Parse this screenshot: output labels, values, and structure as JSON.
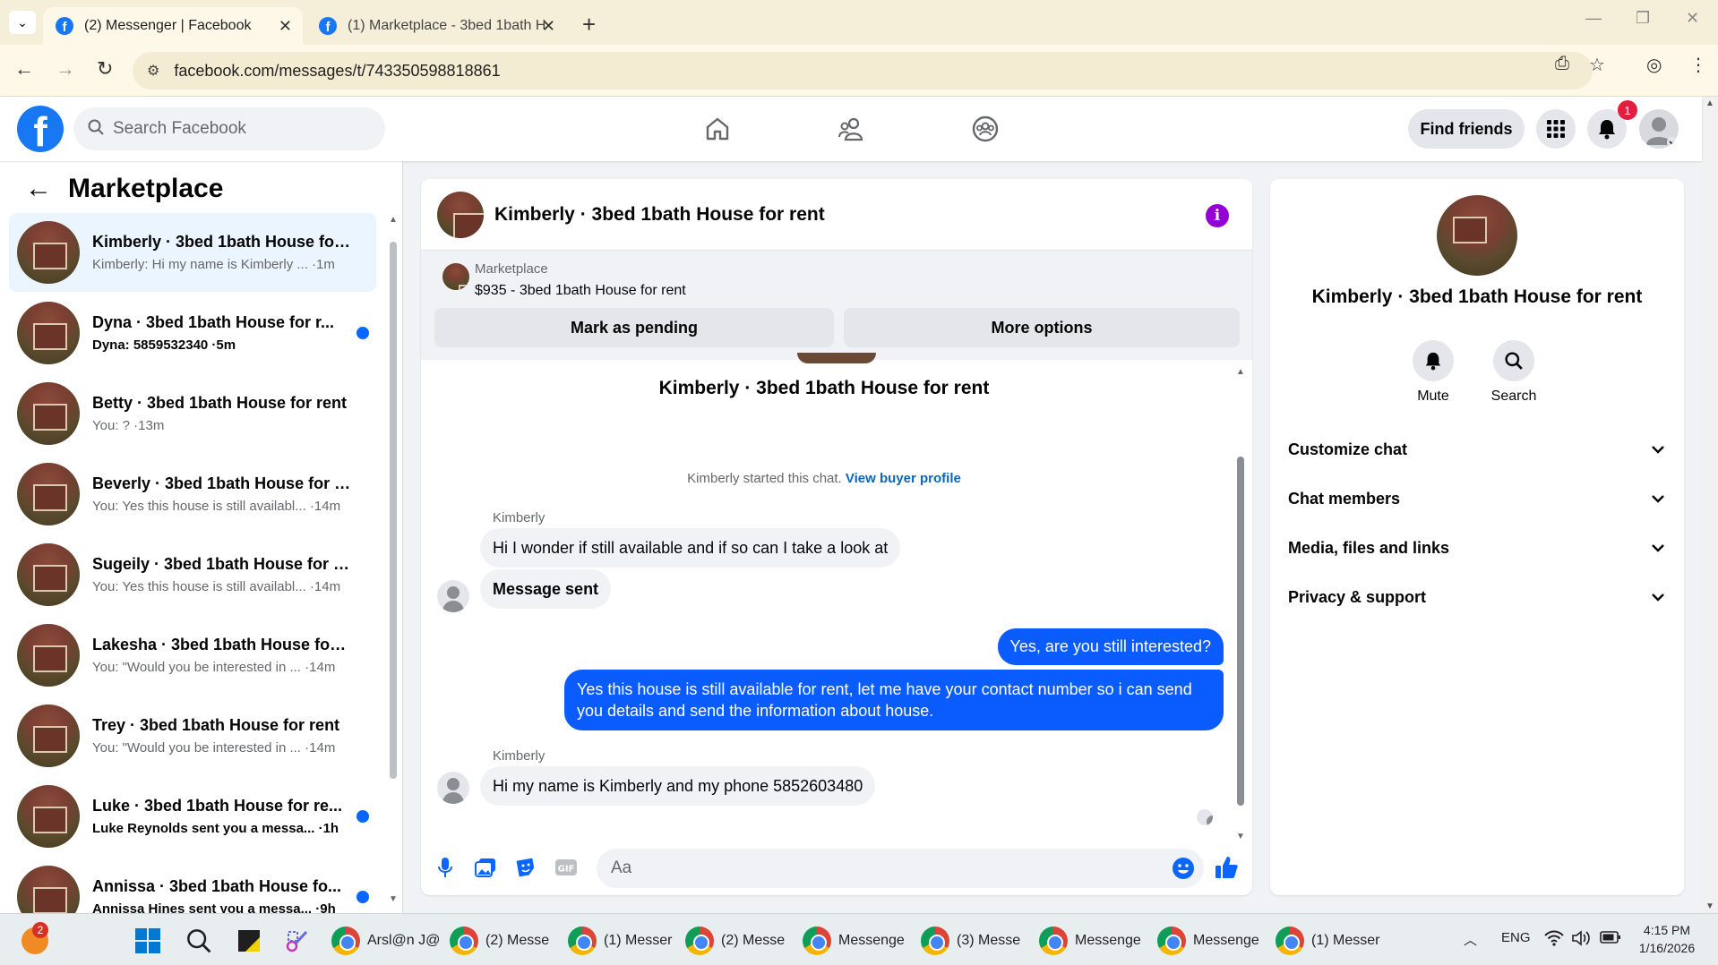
{
  "browser": {
    "tabs": [
      {
        "title": "(2) Messenger | Facebook",
        "active": true
      },
      {
        "title": "(1) Marketplace - 3bed 1bath H",
        "active": false
      }
    ],
    "url": "facebook.com/messages/t/743350598818861"
  },
  "fb_header": {
    "search_placeholder": "Search Facebook",
    "find_friends": "Find friends",
    "notification_count": "1",
    "icons": [
      "home-icon",
      "friends-icon",
      "groups-icon",
      "menu-grid-icon",
      "bell-icon",
      "profile-avatar"
    ]
  },
  "sidebar": {
    "title": "Marketplace",
    "conversations": [
      {
        "name": "Kimberly · 3bed 1bath House for...",
        "preview": "Kimberly: Hi my name is Kimberly ... ·1m",
        "selected": true,
        "unread": false
      },
      {
        "name": "Dyna · 3bed 1bath House for r...",
        "preview": "Dyna: 5859532340 ·5m",
        "selected": false,
        "unread": true
      },
      {
        "name": "Betty · 3bed 1bath House for rent",
        "preview": "You: ? ·13m",
        "selected": false,
        "unread": false
      },
      {
        "name": "Beverly · 3bed 1bath House for r...",
        "preview": "You: Yes this house is still availabl... ·14m",
        "selected": false,
        "unread": false
      },
      {
        "name": "Sugeily · 3bed 1bath House for r...",
        "preview": "You: Yes this house is still availabl... ·14m",
        "selected": false,
        "unread": false
      },
      {
        "name": "Lakesha · 3bed 1bath House for ...",
        "preview": "You: \"Would you be interested in ... ·14m",
        "selected": false,
        "unread": false
      },
      {
        "name": "Trey · 3bed 1bath House for rent",
        "preview": "You: \"Would you be interested in ... ·14m",
        "selected": false,
        "unread": false
      },
      {
        "name": "Luke · 3bed 1bath House for re...",
        "preview": "Luke Reynolds sent you a messa... ·1h",
        "selected": false,
        "unread": true
      },
      {
        "name": "Annissa · 3bed 1bath House fo...",
        "preview": "Annissa Hines sent you a messa... ·9h",
        "selected": false,
        "unread": true
      }
    ]
  },
  "chat": {
    "title": "Kimberly · 3bed 1bath House for rent",
    "listing": {
      "label": "Marketplace",
      "price_title": "$935 - 3bed 1bath House for rent"
    },
    "buttons": {
      "mark_pending": "Mark as pending",
      "more_options": "More options"
    },
    "intro_name": "Kimberly · 3bed 1bath House for rent",
    "started_text": "Kimberly started this chat.",
    "view_profile": "View buyer profile",
    "messages": [
      {
        "sender": "Kimberly",
        "text": "Hi I wonder if still available and if so can I take a look at",
        "direction": "in"
      },
      {
        "text": "Message sent",
        "direction": "in"
      },
      {
        "text": "Yes, are you still interested?",
        "direction": "out"
      },
      {
        "text": "Yes this house is still available for rent, let me have your contact number so i can send you details and send the information about house.",
        "direction": "out"
      },
      {
        "sender": "Kimberly",
        "text": "Hi my name is Kimberly and my phone 5852603480",
        "direction": "in"
      }
    ],
    "composer_placeholder": "Aa"
  },
  "info_panel": {
    "name": "Kimberly · 3bed 1bath House for rent",
    "actions": [
      "Mute",
      "Search"
    ],
    "sections": [
      "Customize chat",
      "Chat members",
      "Media, files and links",
      "Privacy & support"
    ]
  },
  "taskbar": {
    "notification_badge": "2",
    "apps": [
      "Arsl@n J@",
      "(2) Messe",
      "(1) Messer",
      "(2) Messe",
      "Messenge",
      "(3) Messe",
      "Messenge",
      "Messenge",
      "(1) Messer"
    ],
    "language": "ENG",
    "time": "4:15 PM",
    "date": "1/16/2026"
  },
  "colors": {
    "fb_blue": "#1877f2",
    "bubble_out": "#0a5cff",
    "unread_dot": "#0866ff",
    "info_purple": "#9400d3"
  }
}
